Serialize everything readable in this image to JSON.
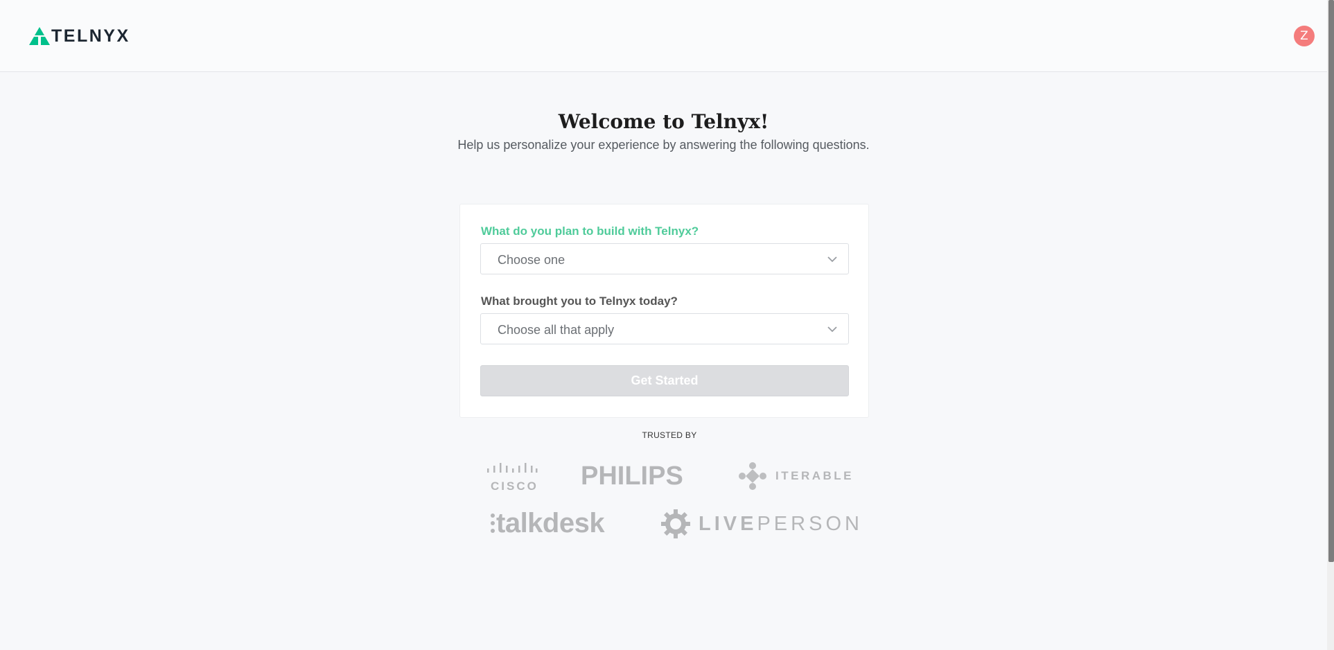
{
  "header": {
    "logo_text": "TELNYX",
    "avatar_initial": "Z"
  },
  "main": {
    "title": "Welcome to Telnyx!",
    "subtitle": "Help us personalize your experience by answering the following questions."
  },
  "form": {
    "q1": {
      "label": "What do you plan to build with Telnyx?",
      "placeholder": "Choose one"
    },
    "q2": {
      "label": "What brought you to Telnyx today?",
      "placeholder": "Choose all that apply"
    },
    "submit_label": "Get Started"
  },
  "trusted": {
    "heading": "TRUSTED BY",
    "logos": {
      "cisco": "CISCO",
      "philips": "PHILIPS",
      "iterable": "ITERABLE",
      "talkdesk": "talkdesk",
      "liveperson_a": "LIVE",
      "liveperson_b": "PERSON"
    }
  },
  "colors": {
    "accent": "#4fcb9a",
    "avatar": "#f47c7c",
    "disabled_button": "#dcdde0"
  }
}
